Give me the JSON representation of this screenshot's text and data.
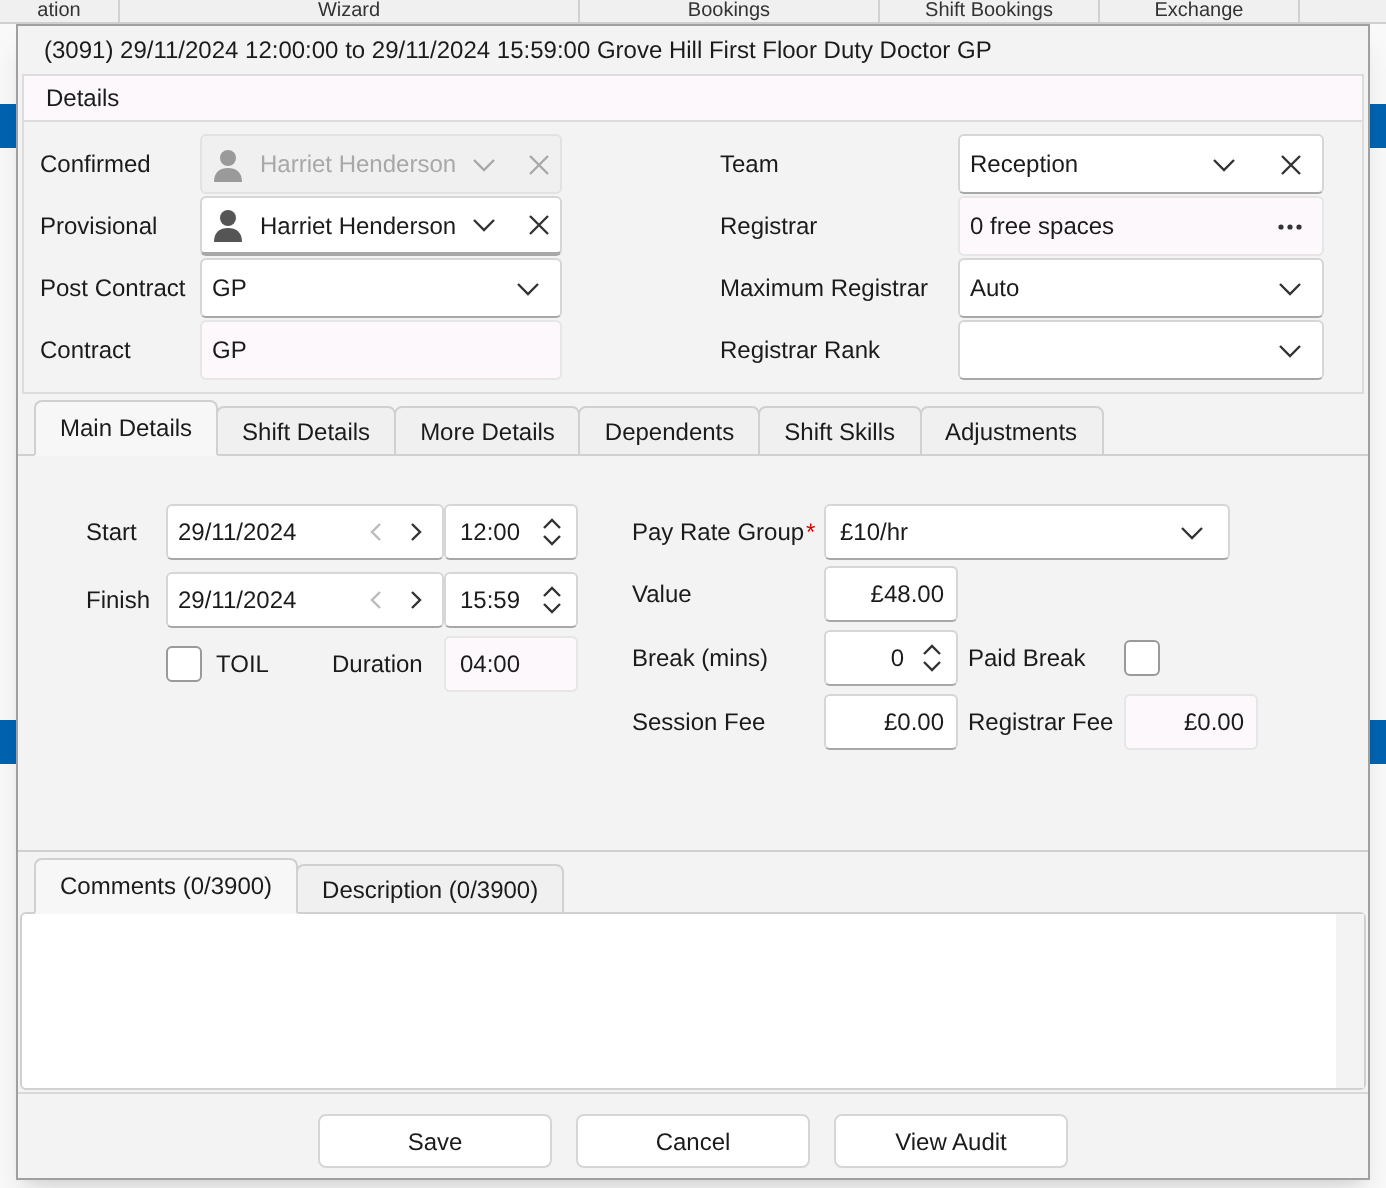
{
  "background": {
    "headers": [
      "ation",
      "Wizard",
      "Bookings",
      "Shift Bookings",
      "Exchange"
    ]
  },
  "window": {
    "title": "(3091) 29/11/2024 12:00:00 to 29/11/2024 15:59:00 Grove Hill First Floor Duty Doctor GP"
  },
  "section": {
    "title": "Details"
  },
  "fields_left": [
    {
      "label": "Confirmed",
      "kind": "person",
      "value": "Harriet Henderson",
      "disabled": true,
      "focused": false
    },
    {
      "label": "Provisional",
      "kind": "person",
      "value": "Harriet Henderson",
      "disabled": false,
      "focused": true
    },
    {
      "label": "Post Contract",
      "kind": "dropdown",
      "value": "GP"
    },
    {
      "label": "Contract",
      "kind": "readonly",
      "value": "GP"
    }
  ],
  "fields_right": [
    {
      "label": "Team",
      "kind": "dropdown_clear",
      "value": "Reception"
    },
    {
      "label": "Registrar",
      "kind": "browse",
      "value": "0 free spaces"
    },
    {
      "label": "Maximum Registrar",
      "kind": "dropdown",
      "value": "Auto"
    },
    {
      "label": "Registrar Rank",
      "kind": "dropdown"
    }
  ],
  "tabs": [
    {
      "label": "Main Details",
      "selected": true
    },
    {
      "label": "Shift Details",
      "selected": false
    },
    {
      "label": "More Details",
      "selected": false
    },
    {
      "label": "Dependents",
      "selected": false
    },
    {
      "label": "Shift Skills",
      "selected": false
    },
    {
      "label": "Adjustments",
      "selected": false
    }
  ],
  "main_details": {
    "start": {
      "label": "Start",
      "date": "29/11/2024",
      "time": "12:00"
    },
    "finish": {
      "label": "Finish",
      "date": "29/11/2024",
      "time": "15:59"
    },
    "toil": {
      "label": "TOIL",
      "checked": false
    },
    "duration": {
      "label": "Duration",
      "value": "04:00"
    },
    "pay_rate_group": {
      "label": "Pay Rate Group",
      "required_marker": "*",
      "value": "£10/hr"
    },
    "value": {
      "label": "Value",
      "value": "£48.00"
    },
    "break": {
      "label": "Break (mins)",
      "value": "0"
    },
    "paid_break": {
      "label": "Paid Break",
      "checked": false
    },
    "session_fee": {
      "label": "Session Fee",
      "value": "£0.00"
    },
    "registrar_fee": {
      "label": "Registrar Fee",
      "value": "£0.00"
    }
  },
  "notes_tabs": [
    {
      "label": "Comments (0/3900)",
      "selected": true
    },
    {
      "label": "Description (0/3900)",
      "selected": false
    }
  ],
  "buttons": [
    "Save",
    "Cancel",
    "View Audit"
  ]
}
